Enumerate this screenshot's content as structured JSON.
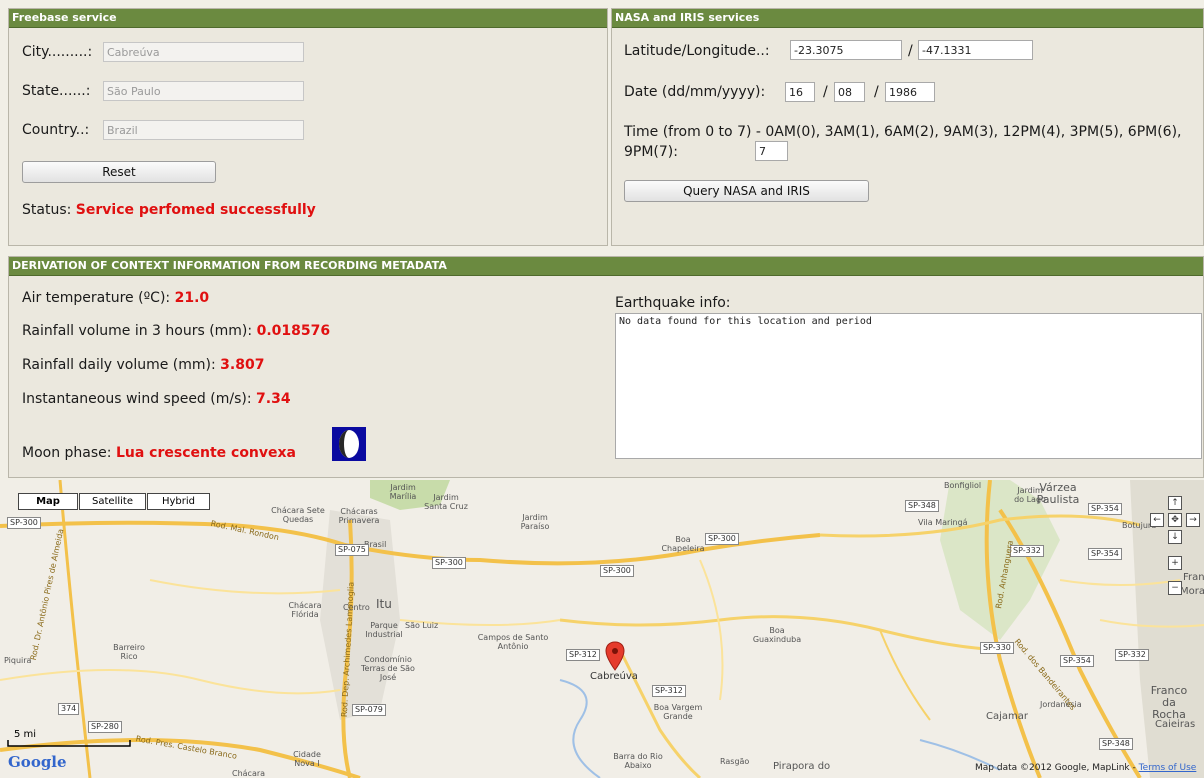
{
  "freebase": {
    "title": "Freebase service",
    "city_label": "City.........:",
    "city_value": "Cabreúva",
    "state_label": "State......:",
    "state_value": "São Paulo",
    "country_label": "Country..:",
    "country_value": "Brazil",
    "reset_label": "Reset",
    "status_label": "Status:",
    "status_value": "Service perfomed successfully"
  },
  "nasa": {
    "title": "NASA and IRIS services",
    "latlon_label": "Latitude/Longitude..:",
    "latitude": "-23.3075",
    "separator": "/",
    "longitude": "-47.1331",
    "date_label": "Date (dd/mm/yyyy):",
    "day": "16",
    "month": "08",
    "year": "1986",
    "time_label": "Time (from 0 to 7) - 0AM(0), 3AM(1), 6AM(2), 9AM(3), 12PM(4), 3PM(5), 6PM(6), 9PM(7):",
    "time_value": "7",
    "query_label": "Query NASA and IRIS"
  },
  "derivation": {
    "title": "DERIVATION OF CONTEXT INFORMATION FROM RECORDING METADATA",
    "air_temp_label": "Air temperature (ºC):",
    "air_temp_value": "21.0",
    "rain3h_label": "Rainfall volume in 3 hours (mm):",
    "rain3h_value": "0.018576",
    "rain_daily_label": "Rainfall daily volume (mm):",
    "rain_daily_value": "3.807",
    "wind_label": "Instantaneous wind speed (m/s):",
    "wind_value": "7.34",
    "moon_label": "Moon phase:",
    "moon_value": "Lua crescente convexa",
    "earthquake_label": "Earthquake info:",
    "earthquake_text": "No data found for this location and period"
  },
  "map": {
    "type_buttons": [
      "Map",
      "Satellite",
      "Hybrid"
    ],
    "marker_label": "Cabreúva",
    "scale_label": "5 mi",
    "google_logo": "Google",
    "attribution": "Map data ©2012 Google, MapLink -",
    "terms": "Terms of Use",
    "place_labels": [
      "Chácara Sete Quedas",
      "Chácaras Primavera",
      "Jardim Marília",
      "Jardim Santa Cruz",
      "Brasil",
      "Jardim Paraíso",
      "Boa Chapeleira",
      "Chácara Flórida",
      "Centro",
      "Itu",
      "Parque Industrial",
      "São Luiz",
      "Barreiro Rico",
      "Campos de Santo Antônio",
      "Boa Guaxinduba",
      "Condomínio Terras de São José",
      "Boa Vargem Grande",
      "Piquira",
      "Cidade Nova I",
      "Chácara",
      "Barra do Rio Abaixo",
      "Rasgão",
      "Pirapora do",
      "Bonfigliol",
      "Jardim do Lago",
      "Várzea Paulista",
      "Vila Maringá",
      "Botujuru",
      "Franco da Rocha",
      "Cajamar",
      "Jordanésia",
      "Caieiras",
      "Franco",
      "Mora"
    ],
    "road_labels": [
      "SP-300",
      "SP-300",
      "SP-300",
      "SP-300",
      "SP-075",
      "SP-312",
      "SP-312",
      "SP-079",
      "SP-280",
      "374",
      "SP-348",
      "SP-354",
      "SP-332",
      "SP-354",
      "SP-330",
      "SP-354",
      "SP-332",
      "SP-348"
    ],
    "road_names": [
      "Rod. Mal. Rondon",
      "Rod. Dr. Antônio Pires de Almeida",
      "Rod. Dep. Archimedes Lammoglia",
      "Rod. Pres. Castelo Branco",
      "Rod. Anhanguera",
      "Rod. dos Bandeirantes"
    ]
  }
}
